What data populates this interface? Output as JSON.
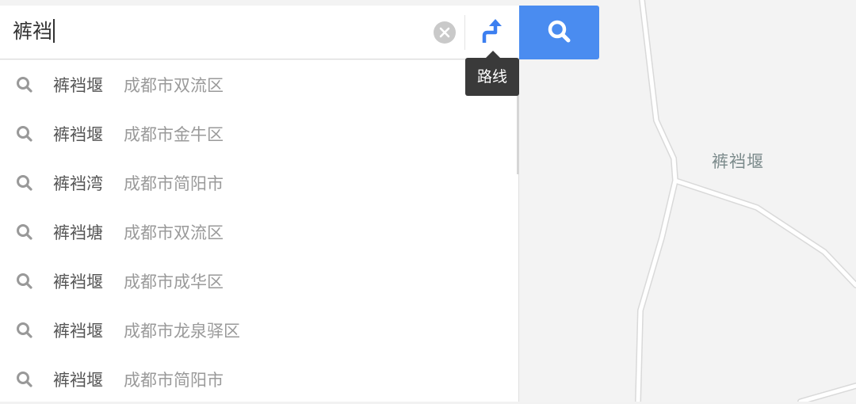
{
  "search": {
    "query": "裤裆"
  },
  "tooltip": {
    "label": "路线"
  },
  "map": {
    "place_label": "裤裆堰"
  },
  "suggestions": [
    {
      "name": "裤裆堰",
      "address": "成都市双流区"
    },
    {
      "name": "裤裆堰",
      "address": "成都市金牛区"
    },
    {
      "name": "裤裆湾",
      "address": "成都市简阳市"
    },
    {
      "name": "裤裆塘",
      "address": "成都市双流区"
    },
    {
      "name": "裤裆堰",
      "address": "成都市成华区"
    },
    {
      "name": "裤裆堰",
      "address": "成都市龙泉驿区"
    },
    {
      "name": "裤裆堰",
      "address": "成都市简阳市"
    }
  ],
  "colors": {
    "accent": "#4a8cf0",
    "tooltip_bg": "#3a3a3a",
    "map_bg": "#f3f3f3"
  },
  "icons": {
    "search": "search-icon",
    "clear": "clear-icon",
    "route": "route-icon"
  }
}
